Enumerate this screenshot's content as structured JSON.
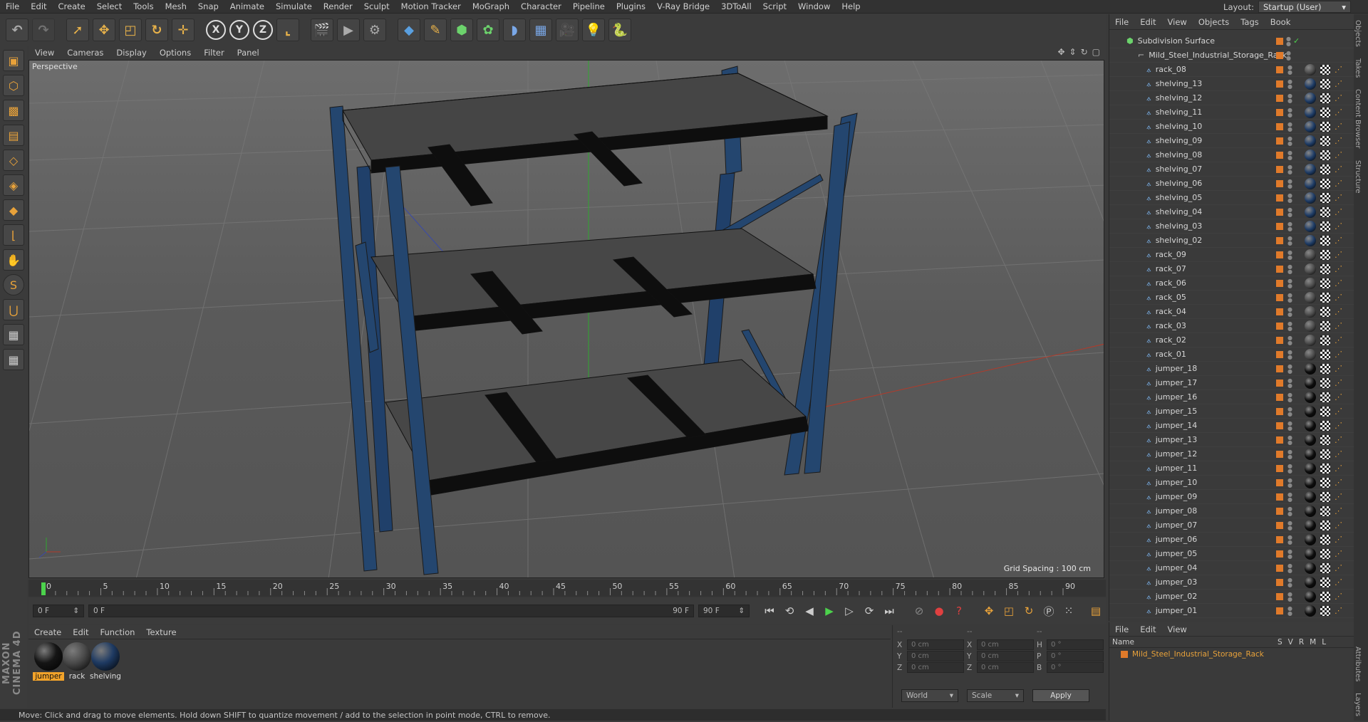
{
  "menu": [
    "File",
    "Edit",
    "Create",
    "Select",
    "Tools",
    "Mesh",
    "Snap",
    "Animate",
    "Simulate",
    "Render",
    "Sculpt",
    "Motion Tracker",
    "MoGraph",
    "Character",
    "Pipeline",
    "Plugins",
    "V-Ray Bridge",
    "3DToAll",
    "Script",
    "Window",
    "Help"
  ],
  "layout": {
    "label": "Layout:",
    "value": "Startup (User)"
  },
  "toolbar": {
    "x": "X",
    "y": "Y",
    "z": "Z"
  },
  "viewport": {
    "menu": [
      "View",
      "Cameras",
      "Display",
      "Options",
      "Filter",
      "Panel"
    ],
    "label": "Perspective",
    "grid_spacing": "Grid Spacing : 100 cm"
  },
  "timeline": {
    "ticks": [
      "0",
      "5",
      "10",
      "15",
      "20",
      "25",
      "30",
      "35",
      "40",
      "45",
      "50",
      "55",
      "60",
      "65",
      "70",
      "75",
      "80",
      "85",
      "90"
    ],
    "current": "0 F",
    "start": "0 F",
    "range_start": "0 F",
    "range_end": "90 F",
    "end": "90 F"
  },
  "materials": {
    "menu": [
      "Create",
      "Edit",
      "Function",
      "Texture"
    ],
    "items": [
      {
        "name": "jumper",
        "color": "#151515"
      },
      {
        "name": "rack",
        "color": "#4a4a4a"
      },
      {
        "name": "shelving",
        "color": "#1e3a62"
      }
    ]
  },
  "coords": {
    "header": [
      "--",
      "--",
      "--"
    ],
    "rows": [
      {
        "a": "X",
        "av": "0 cm",
        "b": "X",
        "bv": "0 cm",
        "c": "H",
        "cv": "0 °"
      },
      {
        "a": "Y",
        "av": "0 cm",
        "b": "Y",
        "bv": "0 cm",
        "c": "P",
        "cv": "0 °"
      },
      {
        "a": "Z",
        "av": "0 cm",
        "b": "Z",
        "bv": "0 cm",
        "c": "B",
        "cv": "0 °"
      }
    ],
    "world": "World",
    "scale": "Scale",
    "apply": "Apply"
  },
  "objects": {
    "menu": [
      "File",
      "Edit",
      "View",
      "Objects",
      "Tags",
      "Book"
    ],
    "root": "Subdivision Surface",
    "group": "Mild_Steel_Industrial_Storage_Rack",
    "items": [
      {
        "name": "rack_08",
        "mat": "rack"
      },
      {
        "name": "shelving_13",
        "mat": "shelving"
      },
      {
        "name": "shelving_12",
        "mat": "shelving"
      },
      {
        "name": "shelving_11",
        "mat": "shelving"
      },
      {
        "name": "shelving_10",
        "mat": "shelving"
      },
      {
        "name": "shelving_09",
        "mat": "shelving"
      },
      {
        "name": "shelving_08",
        "mat": "shelving"
      },
      {
        "name": "shelving_07",
        "mat": "shelving"
      },
      {
        "name": "shelving_06",
        "mat": "shelving"
      },
      {
        "name": "shelving_05",
        "mat": "shelving"
      },
      {
        "name": "shelving_04",
        "mat": "shelving"
      },
      {
        "name": "shelving_03",
        "mat": "shelving"
      },
      {
        "name": "shelving_02",
        "mat": "shelving"
      },
      {
        "name": "rack_09",
        "mat": "rack"
      },
      {
        "name": "rack_07",
        "mat": "rack"
      },
      {
        "name": "rack_06",
        "mat": "rack"
      },
      {
        "name": "rack_05",
        "mat": "rack"
      },
      {
        "name": "rack_04",
        "mat": "rack"
      },
      {
        "name": "rack_03",
        "mat": "rack"
      },
      {
        "name": "rack_02",
        "mat": "rack"
      },
      {
        "name": "rack_01",
        "mat": "rack"
      },
      {
        "name": "jumper_18",
        "mat": "jumper"
      },
      {
        "name": "jumper_17",
        "mat": "jumper"
      },
      {
        "name": "jumper_16",
        "mat": "jumper"
      },
      {
        "name": "jumper_15",
        "mat": "jumper"
      },
      {
        "name": "jumper_14",
        "mat": "jumper"
      },
      {
        "name": "jumper_13",
        "mat": "jumper"
      },
      {
        "name": "jumper_12",
        "mat": "jumper"
      },
      {
        "name": "jumper_11",
        "mat": "jumper"
      },
      {
        "name": "jumper_10",
        "mat": "jumper"
      },
      {
        "name": "jumper_09",
        "mat": "jumper"
      },
      {
        "name": "jumper_08",
        "mat": "jumper"
      },
      {
        "name": "jumper_07",
        "mat": "jumper"
      },
      {
        "name": "jumper_06",
        "mat": "jumper"
      },
      {
        "name": "jumper_05",
        "mat": "jumper"
      },
      {
        "name": "jumper_04",
        "mat": "jumper"
      },
      {
        "name": "jumper_03",
        "mat": "jumper"
      },
      {
        "name": "jumper_02",
        "mat": "jumper"
      },
      {
        "name": "jumper_01",
        "mat": "jumper"
      }
    ]
  },
  "side_tabs": [
    "Objects",
    "Takes",
    "Content Browser",
    "Structure"
  ],
  "side_tabs_bottom": [
    "Attributes",
    "Layers"
  ],
  "attributes": {
    "menu": [
      "File",
      "Edit",
      "View"
    ],
    "name_header": "Name",
    "cols": [
      "S",
      "V",
      "R",
      "M",
      "L"
    ],
    "row": "Mild_Steel_Industrial_Storage_Rack"
  },
  "status": "Move: Click and drag to move elements. Hold down SHIFT to quantize movement / add to the selection in point mode, CTRL to remove.",
  "brand": "MAXON CINEMA 4D"
}
